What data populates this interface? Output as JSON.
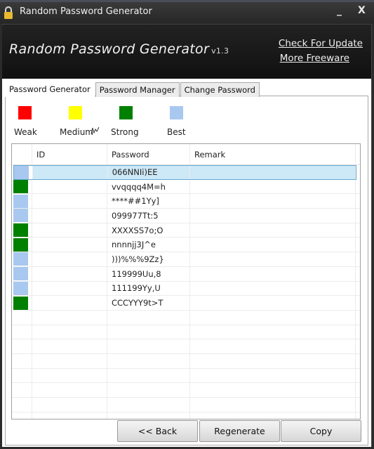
{
  "window": {
    "title": "Random Password Generator",
    "minimize_label": "_",
    "close_label": "X"
  },
  "banner": {
    "title": "Random Password Generator",
    "version": "v1.3",
    "links": {
      "check_update": "Check For Update",
      "more_freeware": "More Freeware"
    }
  },
  "tabs": [
    {
      "label": "Password Generator",
      "active": true
    },
    {
      "label": "Password Manager",
      "active": false
    },
    {
      "label": "Change Password",
      "active": false
    }
  ],
  "legend": [
    {
      "label": "Weak",
      "color": "#ff0000"
    },
    {
      "label": "Medium",
      "color": "#ffff00"
    },
    {
      "label": "Strong",
      "color": "#008000"
    },
    {
      "label": "Best",
      "color": "#a8c8f0"
    }
  ],
  "grid": {
    "columns": [
      "",
      "ID",
      "Password",
      "Remark"
    ],
    "rows": [
      {
        "strength": "Best",
        "color": "#a8c8f0",
        "id": "",
        "password": "066NNIi)EE",
        "remark": "",
        "selected": true
      },
      {
        "strength": "Strong",
        "color": "#008000",
        "id": "",
        "password": "vvqqqq4M=h",
        "remark": ""
      },
      {
        "strength": "Best",
        "color": "#a8c8f0",
        "id": "",
        "password": "****##1Yy]",
        "remark": ""
      },
      {
        "strength": "Best",
        "color": "#a8c8f0",
        "id": "",
        "password": "099977Tt:5",
        "remark": ""
      },
      {
        "strength": "Strong",
        "color": "#008000",
        "id": "",
        "password": "XXXXSS7o;O",
        "remark": ""
      },
      {
        "strength": "Strong",
        "color": "#008000",
        "id": "",
        "password": "nnnnjj3J^e",
        "remark": ""
      },
      {
        "strength": "Best",
        "color": "#a8c8f0",
        "id": "",
        "password": ")))%%%9Zz}",
        "remark": ""
      },
      {
        "strength": "Best",
        "color": "#a8c8f0",
        "id": "",
        "password": "119999Uu,8",
        "remark": ""
      },
      {
        "strength": "Best",
        "color": "#a8c8f0",
        "id": "",
        "password": "111199Yy,U",
        "remark": ""
      },
      {
        "strength": "Strong",
        "color": "#008000",
        "id": "",
        "password": "CCCYYY9t>T",
        "remark": ""
      }
    ],
    "empty_rows": 8
  },
  "buttons": {
    "back": "<< Back",
    "regenerate": "Regenerate",
    "copy": "Copy"
  }
}
